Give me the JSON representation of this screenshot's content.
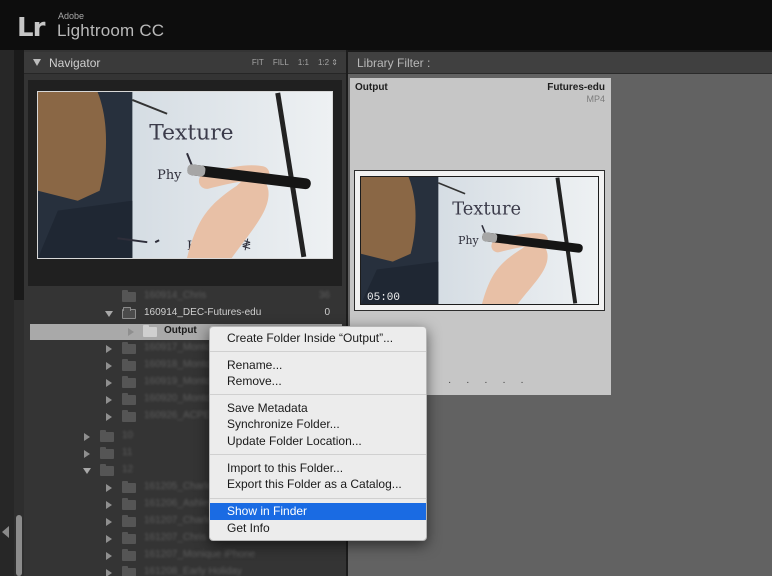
{
  "app": {
    "brand_small": "Adobe",
    "brand_large": "Lightroom CC",
    "logo": "Lr"
  },
  "navigator": {
    "title": "Navigator",
    "zoom_options": [
      "FIT",
      "FILL",
      "1:1",
      "1:2 ⇕"
    ]
  },
  "folders": {
    "expanded_folder": {
      "name": "160914_DEC-Futures-edu",
      "count": "0"
    },
    "selected_folder": {
      "name": "Output"
    }
  },
  "library": {
    "filter_label": "Library Filter :",
    "cell": {
      "name": "Output",
      "folder": "Futures-edu",
      "extension": "MP4",
      "duration": "05:00",
      "dots": "· · · · ·"
    }
  },
  "context_menu": {
    "items": [
      "Create Folder Inside “Output”...",
      "Rename...",
      "Remove...",
      "Save Metadata",
      "Synchronize Folder...",
      "Update Folder Location...",
      "Import to this Folder...",
      "Export this Folder as a Catalog...",
      "Show in Finder",
      "Get Info"
    ],
    "highlighted": "Show in Finder"
  },
  "colors": {
    "menu_highlight": "#1a6be3",
    "panel": "#343434",
    "grid": "#626262"
  }
}
